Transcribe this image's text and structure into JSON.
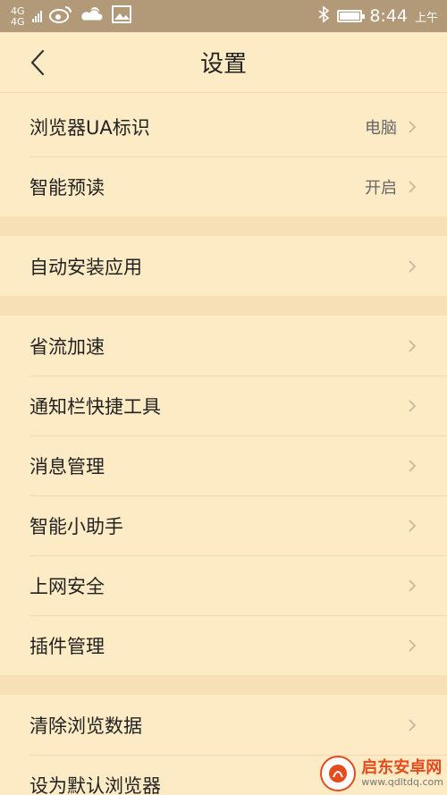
{
  "status_bar": {
    "net1": "4G",
    "net2": "4G",
    "time": "8:44",
    "ampm": "上午",
    "icons": [
      "signal-icon",
      "weibo-icon",
      "weather-icon",
      "image-icon",
      "bluetooth-icon",
      "battery-icon"
    ]
  },
  "header": {
    "title": "设置",
    "back_icon": "back-chevron-icon"
  },
  "groups": [
    {
      "items": [
        {
          "label": "浏览器UA标识",
          "value": "电脑"
        },
        {
          "label": "智能预读",
          "value": "开启"
        }
      ]
    },
    {
      "items": [
        {
          "label": "自动安装应用",
          "value": ""
        }
      ]
    },
    {
      "items": [
        {
          "label": "省流加速",
          "value": ""
        },
        {
          "label": "通知栏快捷工具",
          "value": ""
        },
        {
          "label": "消息管理",
          "value": ""
        },
        {
          "label": "智能小助手",
          "value": ""
        },
        {
          "label": "上网安全",
          "value": ""
        },
        {
          "label": "插件管理",
          "value": ""
        }
      ]
    },
    {
      "items": [
        {
          "label": "清除浏览数据",
          "value": ""
        },
        {
          "label": "设为默认浏览器",
          "value": ""
        }
      ]
    }
  ],
  "watermark": {
    "name": "启东安卓网",
    "url": "www.qdltdq.com"
  },
  "colors": {
    "background": "#fdebc6",
    "status_bar": "#b29a78",
    "divider": "#f0d9b3",
    "group_gap": "#f7dfb6",
    "brand": "#e54b1b"
  }
}
